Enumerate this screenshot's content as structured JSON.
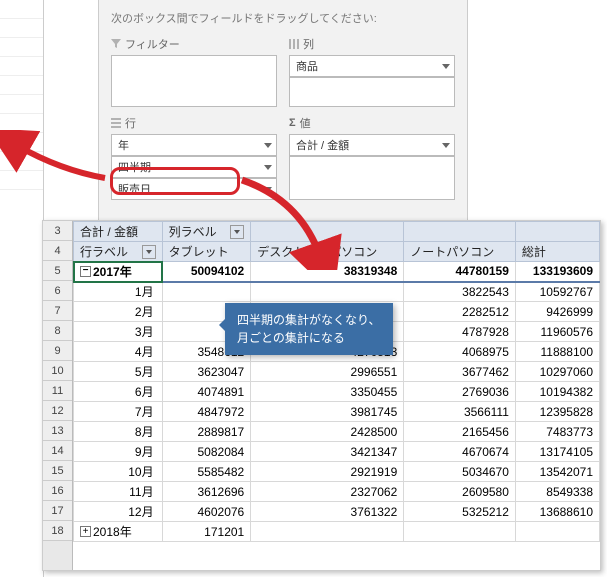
{
  "pane": {
    "hint": "次のボックス間でフィールドをドラッグしてください:",
    "filter_label": "フィルター",
    "columns_label": "列",
    "rows_label": "行",
    "values_label": "値",
    "col_fields": [
      "商品"
    ],
    "row_fields": [
      "年",
      "四半期",
      "販売日"
    ],
    "val_fields": [
      "合計 / 金額"
    ]
  },
  "pivot": {
    "corner": "合計 / 金額",
    "col_label_hdr": "列ラベル",
    "row_label_hdr": "行ラベル",
    "columns": [
      "タブレット",
      "デスクトップパソコン",
      "ノートパソコン",
      "総計"
    ],
    "year2017": "2017年",
    "year2018": "2018年",
    "totals": [
      "50094102",
      "38319348",
      "44780159",
      "133193609"
    ],
    "months": [
      "1月",
      "2月",
      "3月",
      "4月",
      "5月",
      "6月",
      "7月",
      "8月",
      "9月",
      "10月",
      "11月",
      "12月"
    ],
    "data": [
      [
        "",
        "",
        "3822543",
        "10592767"
      ],
      [
        "",
        "",
        "2282512",
        "9426999"
      ],
      [
        "",
        "",
        "4787928",
        "11960576"
      ],
      [
        "3548612",
        "4270513",
        "4068975",
        "11888100"
      ],
      [
        "3623047",
        "2996551",
        "3677462",
        "10297060"
      ],
      [
        "4074891",
        "3350455",
        "2769036",
        "10194382"
      ],
      [
        "4847972",
        "3981745",
        "3566111",
        "12395828"
      ],
      [
        "2889817",
        "2428500",
        "2165456",
        "7483773"
      ],
      [
        "5082084",
        "3421347",
        "4670674",
        "13174105"
      ],
      [
        "5585482",
        "2921919",
        "5034670",
        "13542071"
      ],
      [
        "3612696",
        "2327062",
        "2609580",
        "8549338"
      ],
      [
        "4602076",
        "3761322",
        "5325212",
        "13688610"
      ]
    ],
    "y2018_first": "171201"
  },
  "rowhdrs": [
    "3",
    "4",
    "5",
    "6",
    "7",
    "8",
    "9",
    "10",
    "11",
    "12",
    "13",
    "14",
    "15",
    "16",
    "17",
    "18"
  ],
  "callout": {
    "l1": "四半期の集計がなくなり、",
    "l2": "月ごとの集計になる"
  }
}
